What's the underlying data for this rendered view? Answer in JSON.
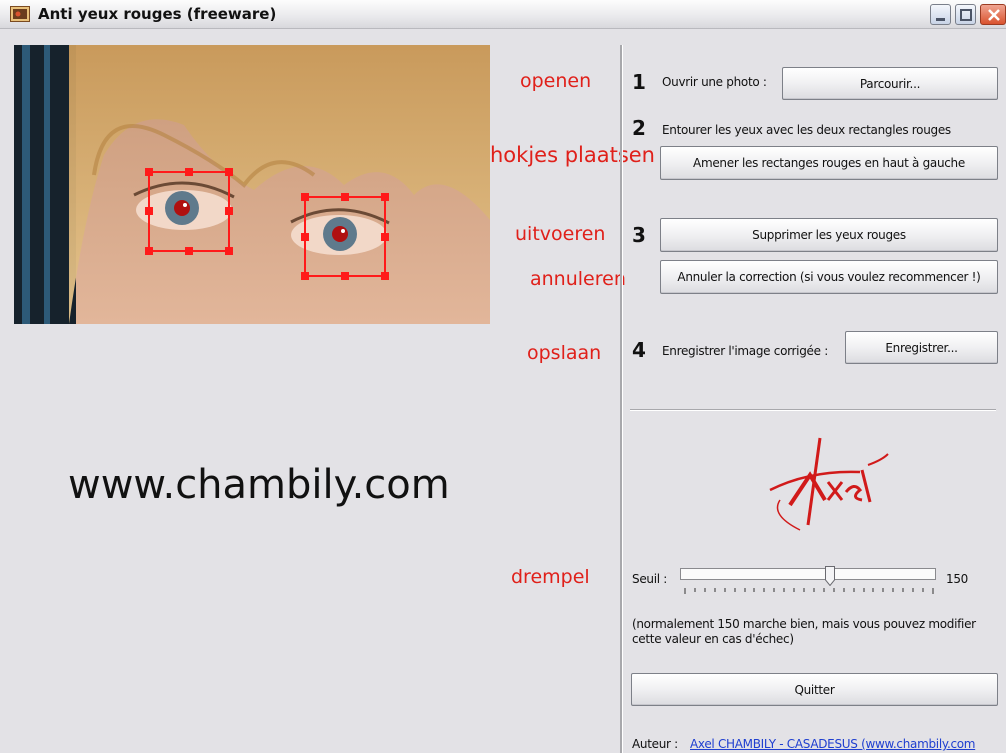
{
  "window": {
    "title": "Anti yeux rouges (freeware)"
  },
  "annotations": {
    "openen": "openen",
    "hokjes": "hokjes plaatsen",
    "uitvoeren": "uitvoeren",
    "annuleren": "annuleren",
    "opslaan": "opslaan",
    "drempel": "drempel"
  },
  "website": "www.chambily.com",
  "steps": {
    "step1": {
      "number": "1",
      "text": "Ouvrir une photo :",
      "button": "Parcourir..."
    },
    "step2": {
      "number": "2",
      "text": "Entourer les yeux avec les deux rectangles rouges",
      "button": "Amener les rectanges rouges en haut à gauche"
    },
    "step3": {
      "number": "3",
      "button": "Supprimer les yeux rouges",
      "undo_button": "Annuler la correction (si vous voulez recommencer !)"
    },
    "step4": {
      "number": "4",
      "text": "Enregistrer l'image corrigée :",
      "button": "Enregistrer..."
    }
  },
  "signature": "Axel",
  "threshold": {
    "label": "Seuil :",
    "value": "150",
    "slider_fraction": 0.59,
    "note": "(normalement 150 marche bien, mais vous pouvez modifier cette valeur en cas d'échec)"
  },
  "quit_button": "Quitter",
  "author": {
    "label": "Auteur :",
    "link": "Axel CHAMBILY - CASADESUS (www.chambily.com"
  },
  "colors": {
    "annotation_red": "#e0201a",
    "selection_red": "#ff1a1a",
    "link_blue": "#1f3fd0",
    "window_bg": "#e3e2e6"
  },
  "icons": {
    "app": "photo-app-icon",
    "minimize": "minimize-icon",
    "maximize": "maximize-icon",
    "close": "close-icon"
  }
}
